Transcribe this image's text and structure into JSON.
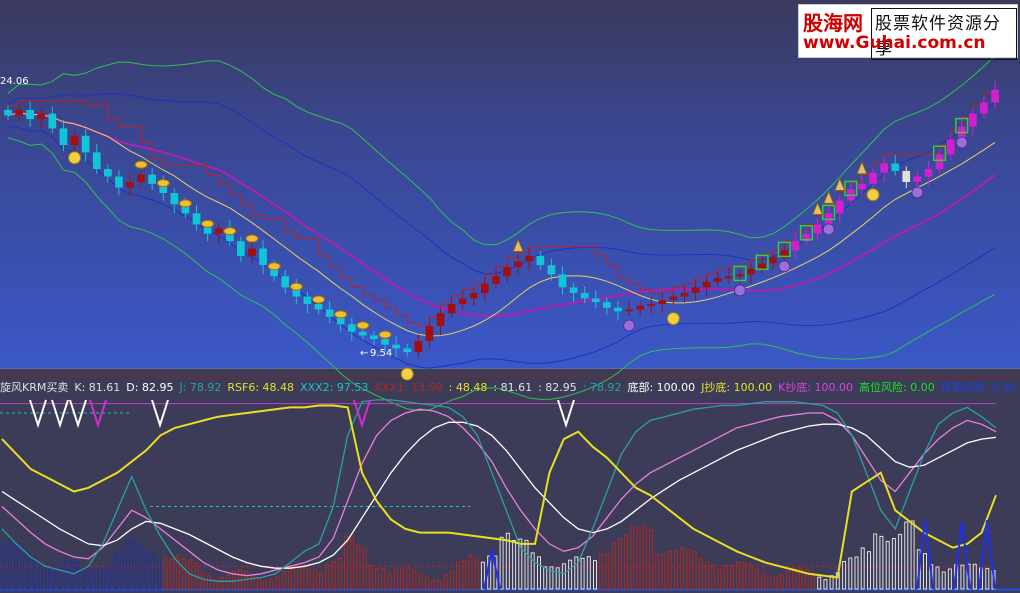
{
  "watermark": {
    "brand": "股海网",
    "slogan": "股票软件资源分享",
    "url": "www.Guhai.com.cn"
  },
  "colors": {
    "top_bg": "#3d56c6",
    "bottom_bg": "#3c3c58",
    "up": "#a01010",
    "down": "#12c4d8",
    "boll_mid": "#2030c0",
    "boll_outer": "#30c050",
    "ma_purple": "#b020b0",
    "ma_yellow": "#e8d060",
    "step_red": "#c02020",
    "K": "#e880e0",
    "D": "#ffffff",
    "J": "#2aa0a0"
  },
  "price_labels": {
    "high": "24.06",
    "low": "9.54"
  },
  "indicator_header": [
    {
      "text": "旋风KRM买卖",
      "color": "#e0e0e0"
    },
    {
      "text": "K: 81.61",
      "color": "#e0e0e0"
    },
    {
      "text": "D: 82.95",
      "color": "#ffffff"
    },
    {
      "text": "J: 78.92",
      "color": "#2aa0a0"
    },
    {
      "text": "RSF6: 48.48",
      "color": "#e8e020"
    },
    {
      "text": "XXX2: 97.53",
      "color": "#20c0c0"
    },
    {
      "text": "XXX1: 13.59",
      "color": "#c02020"
    },
    {
      "text": ": 48.48",
      "color": "#e8e020"
    },
    {
      "text": ": 81.61",
      "color": "#e0e0e0"
    },
    {
      "text": ": 82.95",
      "color": "#e0e0e0"
    },
    {
      "text": ": 78.92",
      "color": "#2aa0a0"
    },
    {
      "text": "底部: 100.00",
      "color": "#ffffff"
    },
    {
      "text": "J抄底: 100.00",
      "color": "#e8e020"
    },
    {
      "text": "K抄底: 100.00",
      "color": "#e040e0"
    },
    {
      "text": "高位风险: 0.00",
      "color": "#20e020"
    },
    {
      "text": "背离风险: 0.00",
      "color": "#2040e0"
    }
  ],
  "chart_data": [
    {
      "type": "candlestick",
      "title": "",
      "note": "daily K-line with Bollinger bands, moving averages and signal icons",
      "close_series": [
        22.5,
        22.8,
        22.3,
        22.6,
        21.8,
        20.9,
        21.4,
        20.5,
        19.6,
        19.2,
        18.6,
        18.9,
        19.3,
        18.8,
        18.3,
        17.7,
        17.2,
        16.6,
        16.1,
        16.4,
        15.7,
        14.9,
        15.3,
        14.4,
        13.8,
        13.2,
        12.7,
        12.3,
        12.0,
        11.6,
        11.2,
        10.8,
        10.6,
        10.4,
        10.1,
        9.9,
        9.7,
        10.3,
        11.1,
        11.8,
        12.3,
        12.6,
        12.9,
        13.4,
        13.8,
        14.3,
        14.6,
        14.9,
        14.4,
        13.9,
        13.2,
        12.9,
        12.6,
        12.4,
        12.1,
        11.9,
        12.0,
        12.2,
        12.3,
        12.5,
        12.7,
        12.9,
        13.2,
        13.5,
        13.7,
        13.8,
        13.9,
        14.2,
        14.5,
        14.8,
        15.2,
        15.7,
        16.1,
        16.6,
        17.2,
        17.9,
        18.5,
        18.8,
        19.4,
        19.9,
        19.5,
        18.9,
        19.2,
        19.6,
        20.4,
        21.2,
        21.9,
        22.6,
        23.2,
        23.9
      ],
      "ylim": [
        9.0,
        25.5
      ]
    },
    {
      "type": "line",
      "title": "旋风KRM买卖",
      "ylim": [
        0,
        100
      ],
      "series": [
        {
          "name": "K",
          "values": [
            42,
            35,
            28,
            22,
            18,
            15,
            14,
            20,
            30,
            40,
            36,
            30,
            24,
            18,
            12,
            8,
            6,
            5,
            6,
            8,
            10,
            12,
            15,
            25,
            45,
            65,
            80,
            88,
            92,
            94,
            93,
            90,
            84,
            76,
            66,
            52,
            40,
            30,
            22,
            18,
            20,
            26,
            36,
            46,
            54,
            60,
            64,
            68,
            72,
            76,
            80,
            84,
            86,
            88,
            90,
            91,
            92,
            92,
            88,
            80,
            68,
            56,
            50,
            60,
            70,
            78,
            84,
            88,
            86,
            82
          ]
        },
        {
          "name": "D",
          "values": [
            50,
            45,
            40,
            35,
            30,
            26,
            22,
            21,
            24,
            30,
            34,
            33,
            30,
            27,
            23,
            19,
            15,
            12,
            10,
            9,
            9,
            10,
            12,
            16,
            24,
            36,
            48,
            60,
            70,
            78,
            84,
            87,
            87,
            85,
            80,
            72,
            62,
            52,
            44,
            36,
            30,
            28,
            30,
            34,
            40,
            46,
            51,
            56,
            60,
            64,
            68,
            72,
            75,
            78,
            81,
            83,
            85,
            86,
            86,
            84,
            80,
            73,
            66,
            63,
            64,
            68,
            72,
            76,
            78,
            79
          ]
        },
        {
          "name": "J",
          "values": [
            30,
            22,
            15,
            10,
            8,
            6,
            10,
            22,
            40,
            58,
            40,
            26,
            14,
            6,
            3,
            2,
            2,
            3,
            4,
            6,
            12,
            18,
            22,
            42,
            80,
            98,
            99,
            99,
            98,
            97,
            96,
            95,
            90,
            80,
            60,
            40,
            20,
            12,
            8,
            6,
            12,
            30,
            50,
            70,
            82,
            88,
            90,
            92,
            94,
            95,
            96,
            96,
            97,
            98,
            98,
            98,
            97,
            96,
            92,
            80,
            60,
            40,
            30,
            50,
            70,
            86,
            92,
            95,
            90,
            84
          ]
        },
        {
          "name": "RSF6",
          "values": [
            78,
            70,
            62,
            58,
            54,
            50,
            52,
            56,
            60,
            66,
            72,
            80,
            84,
            86,
            88,
            90,
            91,
            92,
            93,
            94,
            95,
            95,
            96,
            96,
            95,
            60,
            45,
            35,
            30,
            28,
            28,
            28,
            27,
            26,
            25,
            24,
            22,
            22,
            60,
            78,
            82,
            74,
            68,
            60,
            52,
            48,
            42,
            36,
            30,
            26,
            22,
            18,
            15,
            12,
            10,
            8,
            6,
            5,
            4,
            50,
            55,
            60,
            40,
            34,
            28,
            24,
            20,
            22,
            28,
            48
          ]
        }
      ]
    }
  ]
}
